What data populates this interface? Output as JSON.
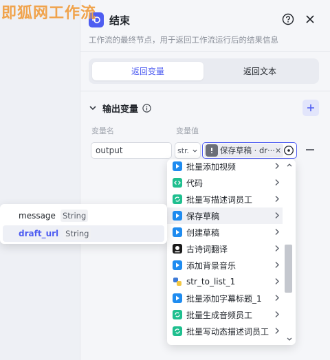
{
  "watermark": "即狐网工作流",
  "header": {
    "title": "结束",
    "description": "工作流的最终节点，用于返回工作流运行后的结果信息",
    "help_icon": "question-circle-icon",
    "close_icon": "close-icon"
  },
  "tabs": [
    {
      "label": "返回变量",
      "active": true
    },
    {
      "label": "返回文本",
      "active": false
    }
  ],
  "output_section": {
    "title": "输出变量",
    "col_name": "变量名",
    "col_value": "变量值",
    "row": {
      "name": "output",
      "type": "str.",
      "ref_label": "保存草稿 · dr···"
    }
  },
  "dropdown": {
    "items": [
      {
        "label": "批量添加视频",
        "icon": "play-icon",
        "color": "#1f8cf0"
      },
      {
        "label": "代码",
        "icon": "code-icon",
        "color": "#1fbf8f"
      },
      {
        "label": "批量写描述词员工",
        "icon": "loop-icon",
        "color": "#1fbf8f"
      },
      {
        "label": "保存草稿",
        "icon": "play-icon",
        "color": "#1f8cf0",
        "hover": true
      },
      {
        "label": "创建草稿",
        "icon": "play-icon",
        "color": "#1f8cf0"
      },
      {
        "label": "古诗词翻译",
        "icon": "bot-icon",
        "color": "#1a1a1a"
      },
      {
        "label": "添加背景音乐",
        "icon": "play-icon",
        "color": "#1f8cf0"
      },
      {
        "label": "str_to_list_1",
        "icon": "python-icon",
        "color": "#3f7bd8"
      },
      {
        "label": "批量添加字幕标题_1",
        "icon": "play-icon",
        "color": "#1f8cf0"
      },
      {
        "label": "批量生成音频员工",
        "icon": "loop-icon",
        "color": "#1fbf8f"
      },
      {
        "label": "批量写动态描述词员工",
        "icon": "loop-icon",
        "color": "#1fbf8f"
      }
    ]
  },
  "sub_popup": {
    "items": [
      {
        "name": "message",
        "type": "String",
        "selected": false
      },
      {
        "name": "draft_url",
        "type": "String",
        "selected": true
      }
    ]
  }
}
